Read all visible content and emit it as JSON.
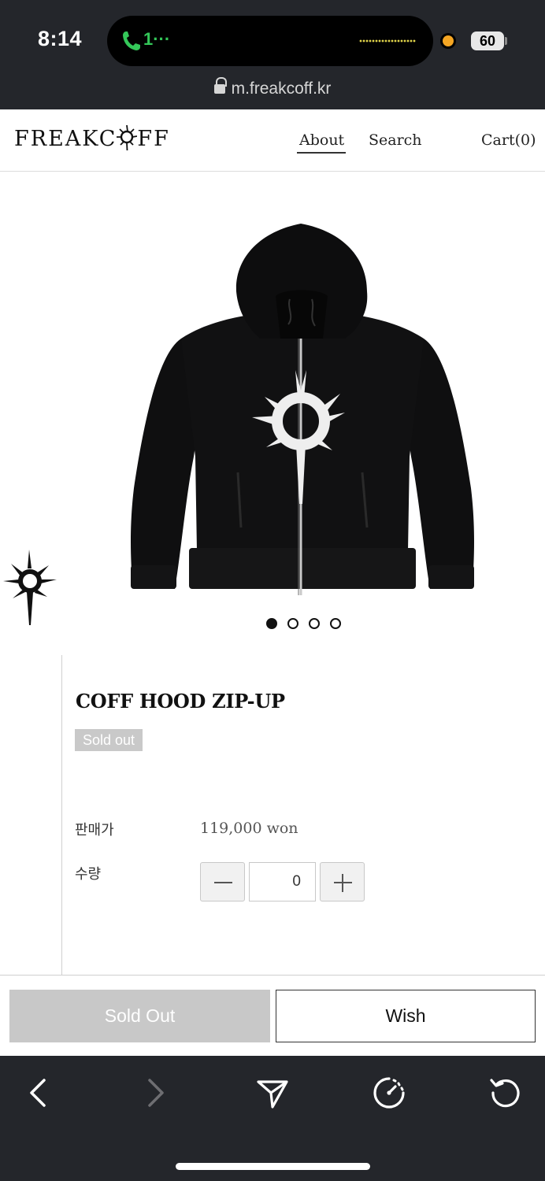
{
  "status_bar": {
    "time": "8:14",
    "call_indicator": "1···",
    "battery": "60",
    "icons": [
      "phone-icon",
      "battery-icon",
      "privacy-dot"
    ]
  },
  "browser": {
    "url": "m.freakcoff.kr",
    "toolbar_icons": [
      "back-icon",
      "forward-icon",
      "share-icon",
      "speedometer-icon",
      "reload-icon"
    ]
  },
  "site": {
    "logo_left": "FREAKC",
    "logo_right": "FF",
    "nav": {
      "about": "About",
      "search": "Search",
      "cart": "Cart(0)"
    }
  },
  "product": {
    "name": "COFF HOOD ZIP-UP",
    "status_badge": "Sold out",
    "price_label": "판매가",
    "price_value": "119,000 won",
    "quantity_label": "수량",
    "quantity_value": "0",
    "image_count": 4,
    "active_image": 1,
    "image_icon": "hoodie-image"
  },
  "actions": {
    "sold_out_label": "Sold Out",
    "wish_label": "Wish"
  },
  "colors": {
    "chrome_dark": "#24262b",
    "call_green": "#34c759",
    "disabled_gray": "#c8c8c8"
  }
}
